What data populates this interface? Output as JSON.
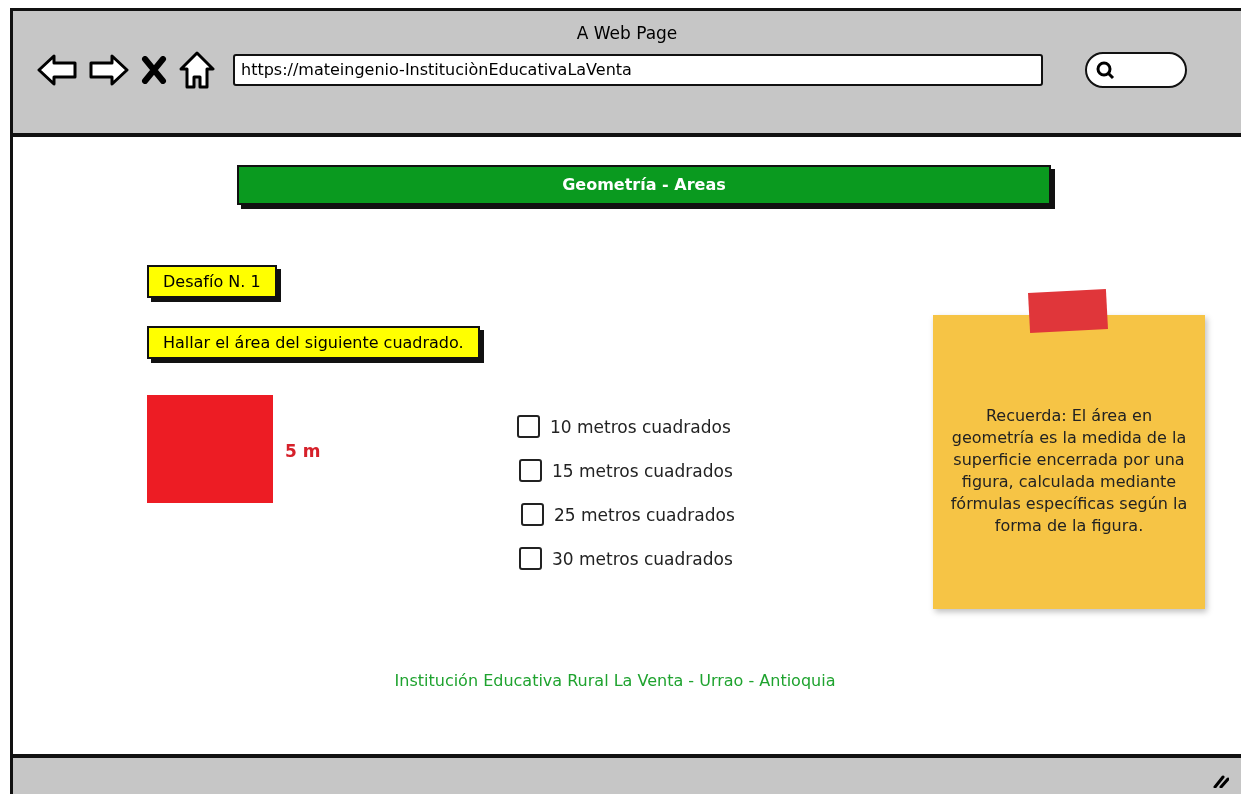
{
  "window": {
    "title": "A Web Page"
  },
  "address_bar": {
    "value": "https://mateingenio-InstituciònEducativaLaVenta"
  },
  "header": {
    "title": "Geometría - Areas"
  },
  "challenge": {
    "label": "Desafío N. 1",
    "question": "Hallar el área del siguiente cuadrado.",
    "figure": {
      "side_label": "5 m"
    }
  },
  "options": [
    {
      "label": "10 metros cuadrados",
      "checked": false
    },
    {
      "label": "15 metros cuadrados",
      "checked": false
    },
    {
      "label": "25 metros cuadrados",
      "checked": false
    },
    {
      "label": "30 metros cuadrados",
      "checked": false
    }
  ],
  "note": {
    "text": "Recuerda: El área en geometría es la medida de la superficie encerrada por una figura, calculada mediante fórmulas específicas según la forma de la figura."
  },
  "footer": {
    "text": "Institución Educativa Rural La Venta - Urrao - Antioquia"
  }
}
